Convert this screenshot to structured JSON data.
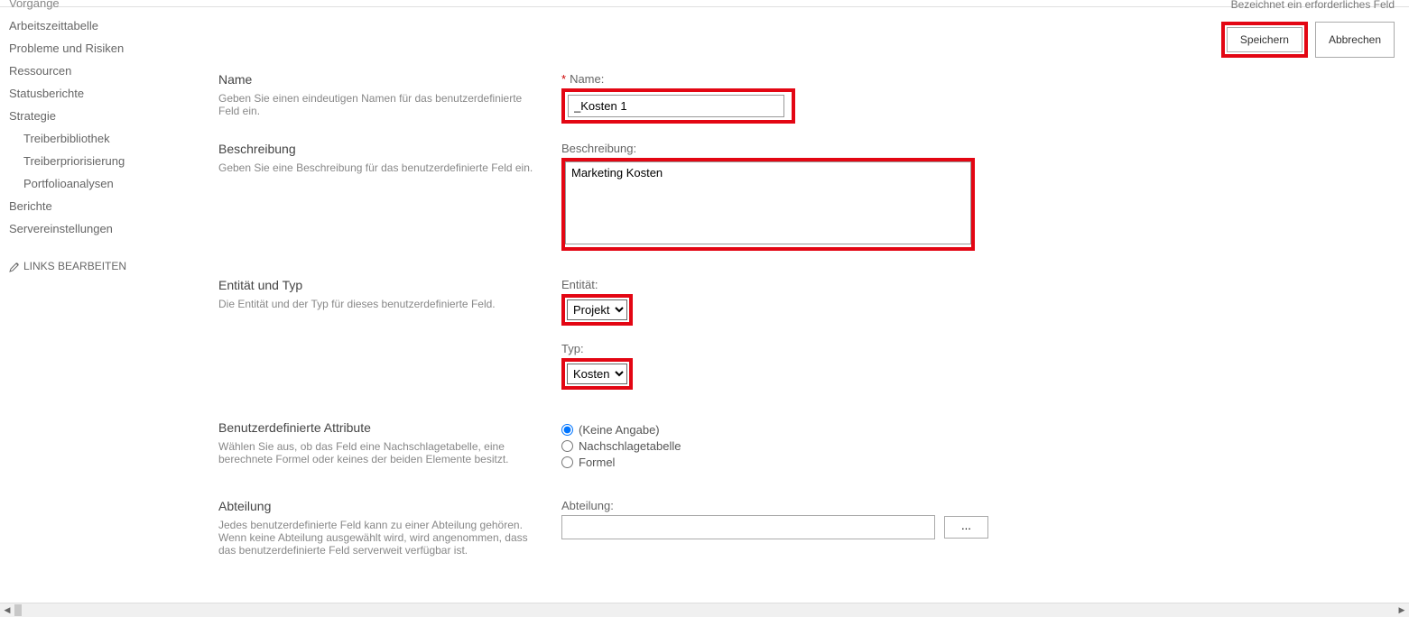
{
  "topRight": {
    "requiredNote": "Bezeichnet ein erforderliches Feld",
    "saveLabel": "Speichern",
    "cancelLabel": "Abbrechen"
  },
  "sidebar": {
    "items": [
      "Vorgänge",
      "Arbeitszeittabelle",
      "Probleme und Risiken",
      "Ressourcen",
      "Statusberichte",
      "Strategie"
    ],
    "subItems": [
      "Treiberbibliothek",
      "Treiberpriorisierung",
      "Portfolioanalysen"
    ],
    "items2": [
      "Berichte",
      "Servereinstellungen"
    ],
    "editLinks": "LINKS BEARBEITEN"
  },
  "sections": {
    "name": {
      "title": "Name",
      "desc": "Geben Sie einen eindeutigen Namen für das benutzerdefinierte Feld ein.",
      "fieldLabel": "Name:",
      "value": "_Kosten 1"
    },
    "beschreibung": {
      "title": "Beschreibung",
      "desc": "Geben Sie eine Beschreibung für das benutzerdefinierte Feld ein.",
      "fieldLabel": "Beschreibung:",
      "value": "Marketing Kosten"
    },
    "entitaet": {
      "title": "Entität und Typ",
      "desc": "Die Entität und der Typ für dieses benutzerdefinierte Feld.",
      "entityLabel": "Entität:",
      "entityValue": "Projekt",
      "typeLabel": "Typ:",
      "typeValue": "Kosten"
    },
    "attribute": {
      "title": "Benutzerdefinierte Attribute",
      "desc": "Wählen Sie aus, ob das Feld eine Nachschlagetabelle, eine berechnete Formel oder keines der beiden Elemente besitzt.",
      "optNone": "(Keine Angabe)",
      "optLookup": "Nachschlagetabelle",
      "optFormula": "Formel"
    },
    "abteilung": {
      "title": "Abteilung",
      "desc": "Jedes benutzerdefinierte Feld kann zu einer Abteilung gehören. Wenn keine Abteilung ausgewählt wird, wird angenommen, dass das benutzerdefinierte Feld serverweit verfügbar ist.",
      "fieldLabel": "Abteilung:",
      "value": "",
      "browseLabel": "..."
    }
  }
}
